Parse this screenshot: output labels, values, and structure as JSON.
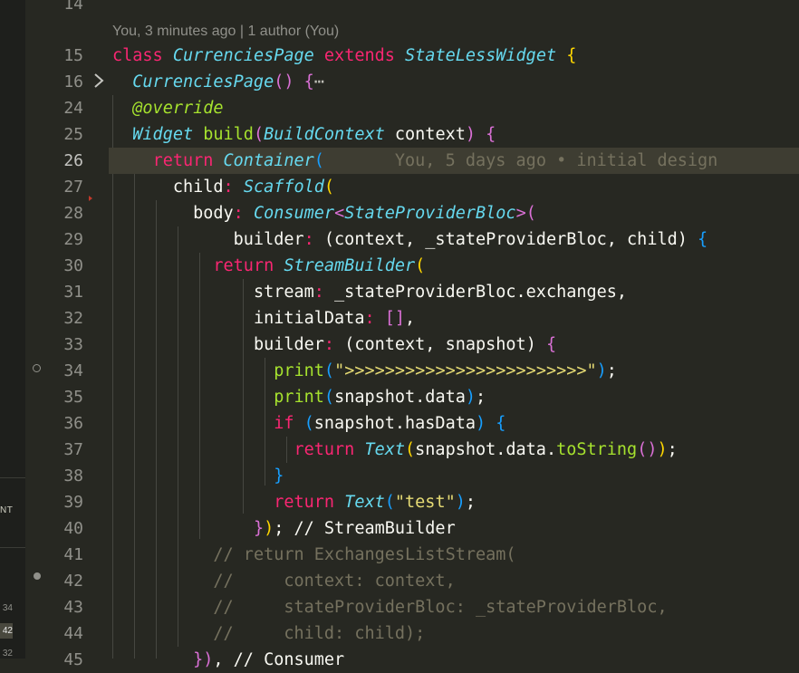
{
  "blame_header": "You, 3 minutes ago | 1 author (You)",
  "inline_blame": "You, 5 days ago • initial design",
  "left_panel": {
    "label_fragment": "NT",
    "line_numbers": [
      "34",
      "42",
      "32"
    ]
  },
  "line_numbers": [
    "14",
    "15",
    "16",
    "24",
    "25",
    "26",
    "27",
    "28",
    "29",
    "30",
    "31",
    "32",
    "33",
    "34",
    "35",
    "36",
    "37",
    "38",
    "39",
    "40",
    "41",
    "42",
    "43",
    "44",
    "45"
  ],
  "code": {
    "l15": {
      "kw1": "class",
      "cls1": "CurrenciesPage",
      "kw2": "extends",
      "cls2": "StateLessWidget",
      "brace": "{"
    },
    "l16": {
      "cls": "CurrenciesPage",
      "paren": "()",
      "brace": "{",
      "ellipsis": "⋯"
    },
    "l24": {
      "ann": "@override"
    },
    "l25": {
      "cls1": "Widget",
      "fn": "build",
      "p_open": "(",
      "cls2": "BuildContext",
      "arg": " context",
      "p_close": ")",
      "brace": "{"
    },
    "l26": {
      "kw": "return",
      "cls": "Container",
      "p_open": "("
    },
    "l27": {
      "prop": "child",
      "colon": ":",
      "cls": "Scaffold",
      "p_open": "("
    },
    "l28": {
      "prop": "body",
      "colon": ":",
      "cls1": "Consumer",
      "lt": "<",
      "cls2": "StateProviderBloc",
      "gt": ">",
      "p_open": "("
    },
    "l29": {
      "prop": "builder",
      "colon": ":",
      "p_open": "(",
      "args": "context, _stateProviderBloc, child",
      "p_close": ")",
      "brace": "{"
    },
    "l30": {
      "kw": "return",
      "cls": "StreamBuilder",
      "p_open": "("
    },
    "l31": {
      "prop": "stream",
      "colon": ":",
      "val": " _stateProviderBloc.exchanges,"
    },
    "l32": {
      "prop": "initialData",
      "colon": ":",
      "brk": "[]",
      "comma": ","
    },
    "l33": {
      "prop": "builder",
      "colon": ":",
      "p_open": "(",
      "args": "context, snapshot",
      "p_close": ")",
      "brace": "{"
    },
    "l34": {
      "fn": "print",
      "p_open": "(",
      "str": "\">>>>>>>>>>>>>>>>>>>>>>>>\"",
      "p_close": ")",
      "semi": ";"
    },
    "l35": {
      "fn": "print",
      "p_open": "(",
      "args": "snapshot.data",
      "p_close": ")",
      "semi": ";"
    },
    "l36": {
      "kw": "if",
      "p_open": "(",
      "args": "snapshot.hasData",
      "p_close": ")",
      "brace": "{"
    },
    "l37": {
      "kw": "return",
      "cls": "Text",
      "p_open": "(",
      "args": "snapshot.data.",
      "fn": "toString",
      "p2": "()",
      "p_close": ")",
      "semi": ";"
    },
    "l38": {
      "brace": "}"
    },
    "l39": {
      "kw": "return",
      "cls": "Text",
      "p_open": "(",
      "str": "\"test\"",
      "p_close": ")",
      "semi": ";"
    },
    "l40": {
      "brace": "}",
      "p_close": ")",
      "tail": "; // StreamBuilder"
    },
    "l41": {
      "cm": "// return ExchangesListStream("
    },
    "l42": {
      "cm": "//     context: context,"
    },
    "l43": {
      "cm": "//     stateProviderBloc: _stateProviderBloc,"
    },
    "l44": {
      "cm": "//     child: child);"
    },
    "l45": {
      "brace": "}",
      "p_close": ")",
      "tail": ", // Consumer"
    }
  },
  "colors": {
    "background": "#272822",
    "keyword": "#f92672",
    "class": "#66d9ef",
    "function": "#a6e22e",
    "string": "#e6db74",
    "comment": "#75715e",
    "bracket_gold": "#ffd700",
    "bracket_orchid": "#da70d6",
    "bracket_blue": "#179fff"
  },
  "icons": [
    "fold-chevron-icon",
    "lightbulb-icon",
    "breakpoint-icon"
  ]
}
